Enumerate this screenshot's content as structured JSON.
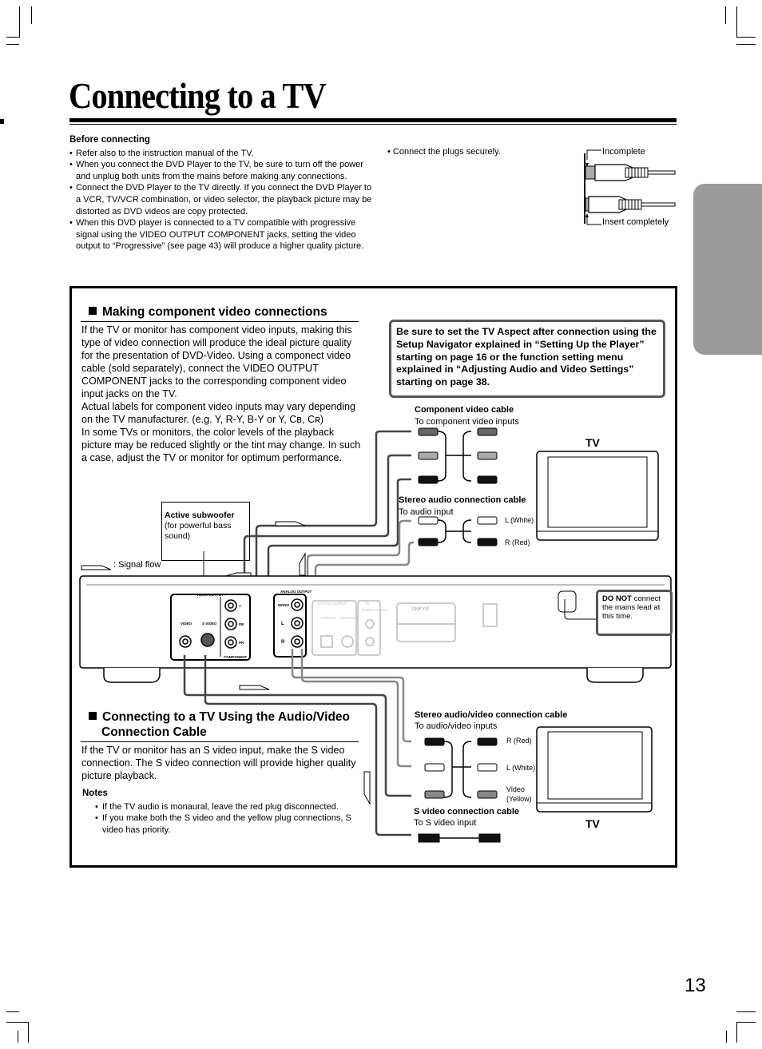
{
  "page": {
    "title": "Connecting to a TV",
    "page_number": "13"
  },
  "before_connecting": {
    "heading": "Before connecting",
    "items": [
      "Refer also to the instruction manual of the TV.",
      "When you connect the DVD Player to the TV, be sure to turn off the power and unplug both units from the mains before making any connections.",
      "Connect the DVD Player to the TV directly. If you connect the DVD Player to a VCR, TV/VCR combination, or video selector, the playback picture may be distorted as DVD videos are copy protected.",
      "When this DVD player is connected to a TV compatible with progressive signal using the VIDEO OUTPUT COMPONENT jacks, setting the video output to “Progressive” (see page 43) will produce a higher quality picture."
    ]
  },
  "plug_tip": {
    "text": "• Connect the plugs securely.",
    "incomplete_label": "Incomplete",
    "complete_label": "Insert completely"
  },
  "component_section": {
    "heading": "Making component video connections",
    "paragraph_1": "If the TV or monitor has component video inputs, making this type of video connection will produce the ideal picture quality for the presentation of DVD-Video. Using a componect video cable (sold separately), connect the VIDEO OUTPUT COMPONENT  jacks to the corresponding component video input jacks on the TV.",
    "paragraph_2": "Actual labels for component video inputs may vary depending on the TV manufacturer. (e.g. Y, R-Y, B-Y or Y, Cʙ, Cʀ)",
    "paragraph_3": "In some TVs or monitors, the color levels of the playback picture may be reduced slightly or the tint may change. In such a case, adjust the TV or monitor for optimum performance."
  },
  "notice": {
    "text": "Be sure to set the TV Aspect after connection using the Setup Navigator explained in “Setting Up the Player” starting on page 16 or the function setting menu explained in “Adjusting Audio and Video Settings” starting on page 38."
  },
  "diagram": {
    "component_cable_title": "Component video cable",
    "component_cable_sub": "To component video inputs",
    "stereo_cable_title": "Stereo audio connection cable",
    "stereo_cable_sub": "To audio input",
    "l_white": "L (White)",
    "r_red": "R (Red)",
    "tv_label": "TV",
    "subwoofer_title": "Active subwoofer",
    "subwoofer_sub": "(for powerful bass sound)",
    "signal_flow": ": Signal flow",
    "do_not_bold": "DO NOT",
    "do_not_rest": " connect the mains lead at this time.",
    "jack_labels": {
      "video_output": "VIDEO OUTPUT",
      "video": "VIDEO",
      "s_video": "S VIDEO",
      "component": "COMPONENT",
      "y": "Y",
      "pb": "PB",
      "pr": "PR",
      "analog_output": "ANALOG OUTPUT",
      "mono": "MONO",
      "l": "L",
      "r": "R",
      "digital_output": "DIGITAL OUTPUT",
      "optical": "OPTICAL",
      "coaxial": "COAXIAL",
      "remote_control": "REMOTE CONTROL",
      "ri": "RI",
      "brand": "ONKYO"
    },
    "av_cable_title": "Stereo audio/video connection cable",
    "av_cable_sub": "To audio/video inputs",
    "video_yellow_1": "Video",
    "video_yellow_2": "(Yellow)",
    "svideo_cable_title": "S video connection cable",
    "svideo_cable_sub": "To S video input"
  },
  "av_section": {
    "heading_line1": "Connecting to a TV Using the Audio/Video",
    "heading_line2": "Connection Cable",
    "paragraph": "If the TV or monitor has an S video input, make the S video connection. The S video connection will provide higher quality picture playback.",
    "notes_heading": "Notes",
    "notes": [
      "If the TV audio is monaural, leave the red plug disconnected.",
      "If you make both the S video and the yellow plug connections, S video has priority."
    ]
  },
  "colors": {
    "side_tab": "#9b9b9b",
    "notice_border": "#555555",
    "plug_dark": "#111111",
    "plug_mid": "#8a8a8a",
    "plug_gray": "#5f5f5f",
    "plug_light": "#ffffff"
  }
}
